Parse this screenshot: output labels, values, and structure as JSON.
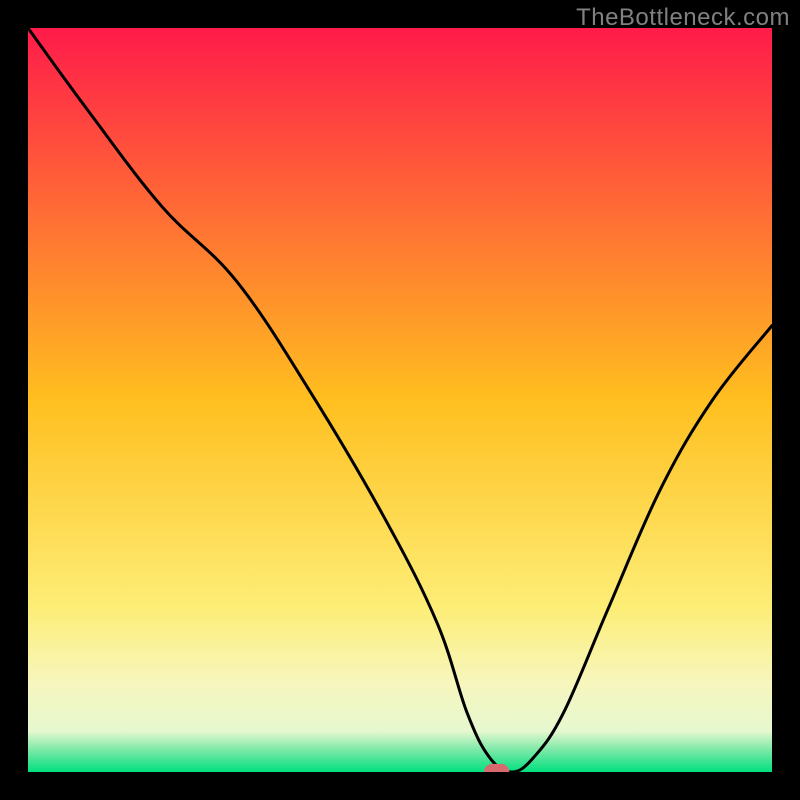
{
  "watermark": "TheBottleneck.com",
  "chart_data": {
    "type": "line",
    "title": "",
    "xlabel": "",
    "ylabel": "",
    "xlim": [
      0,
      100
    ],
    "ylim": [
      0,
      100
    ],
    "grid": false,
    "legend": false,
    "background_gradient": {
      "stops": [
        {
          "pos": 0.0,
          "color": "#ff1b4a"
        },
        {
          "pos": 0.5,
          "color": "#ffbf1f"
        },
        {
          "pos": 0.78,
          "color": "#fdee77"
        },
        {
          "pos": 0.88,
          "color": "#f7f6bd"
        },
        {
          "pos": 0.945,
          "color": "#e6f8cf"
        },
        {
          "pos": 0.97,
          "color": "#7de9a8"
        },
        {
          "pos": 1.0,
          "color": "#00e07f"
        }
      ]
    },
    "series": [
      {
        "name": "bottleneck-curve",
        "color": "#000000",
        "x": [
          0,
          8,
          18,
          28,
          38,
          48,
          55,
          59,
          62,
          65,
          68,
          72,
          78,
          85,
          92,
          100
        ],
        "y": [
          100,
          89,
          76,
          66,
          51,
          34,
          20,
          8,
          2,
          0,
          2,
          8,
          22,
          38,
          50,
          60
        ]
      }
    ],
    "marker": {
      "name": "target-marker",
      "shape": "rounded-rect",
      "x": 63,
      "y": 0,
      "width": 3.4,
      "height": 2.2,
      "color": "#d86a6f"
    }
  }
}
